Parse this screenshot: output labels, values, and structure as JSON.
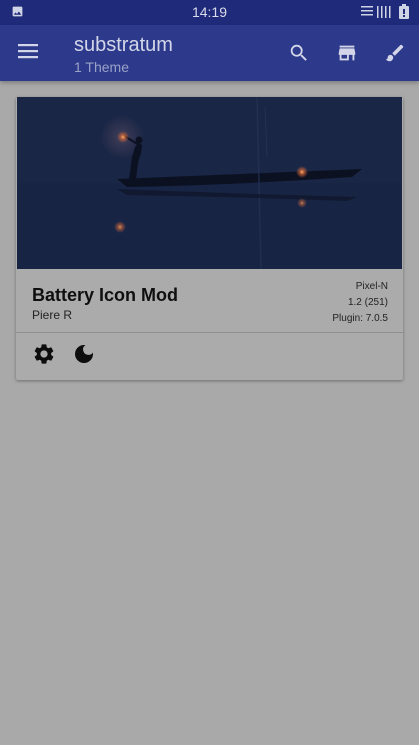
{
  "status_bar": {
    "time": "14:19",
    "icons": [
      "image-icon",
      "signal-icon",
      "battery-icon"
    ]
  },
  "app_bar": {
    "title": "substratum",
    "subtitle": "1 Theme",
    "icons": [
      "menu-icon",
      "search-icon",
      "store-icon",
      "brush-icon"
    ]
  },
  "theme_card": {
    "name": "Battery Icon Mod",
    "author": "Piere R",
    "device": "Pixel-N",
    "version": "1.2 (251)",
    "plugin": "Plugin: 7.0.5",
    "actions": [
      "settings-icon",
      "night-mode-icon"
    ]
  },
  "colors": {
    "status_bar": "#1f2a7a",
    "app_bar": "#2d3a8c",
    "background": "#a9a9a9",
    "card": "#ababab"
  }
}
